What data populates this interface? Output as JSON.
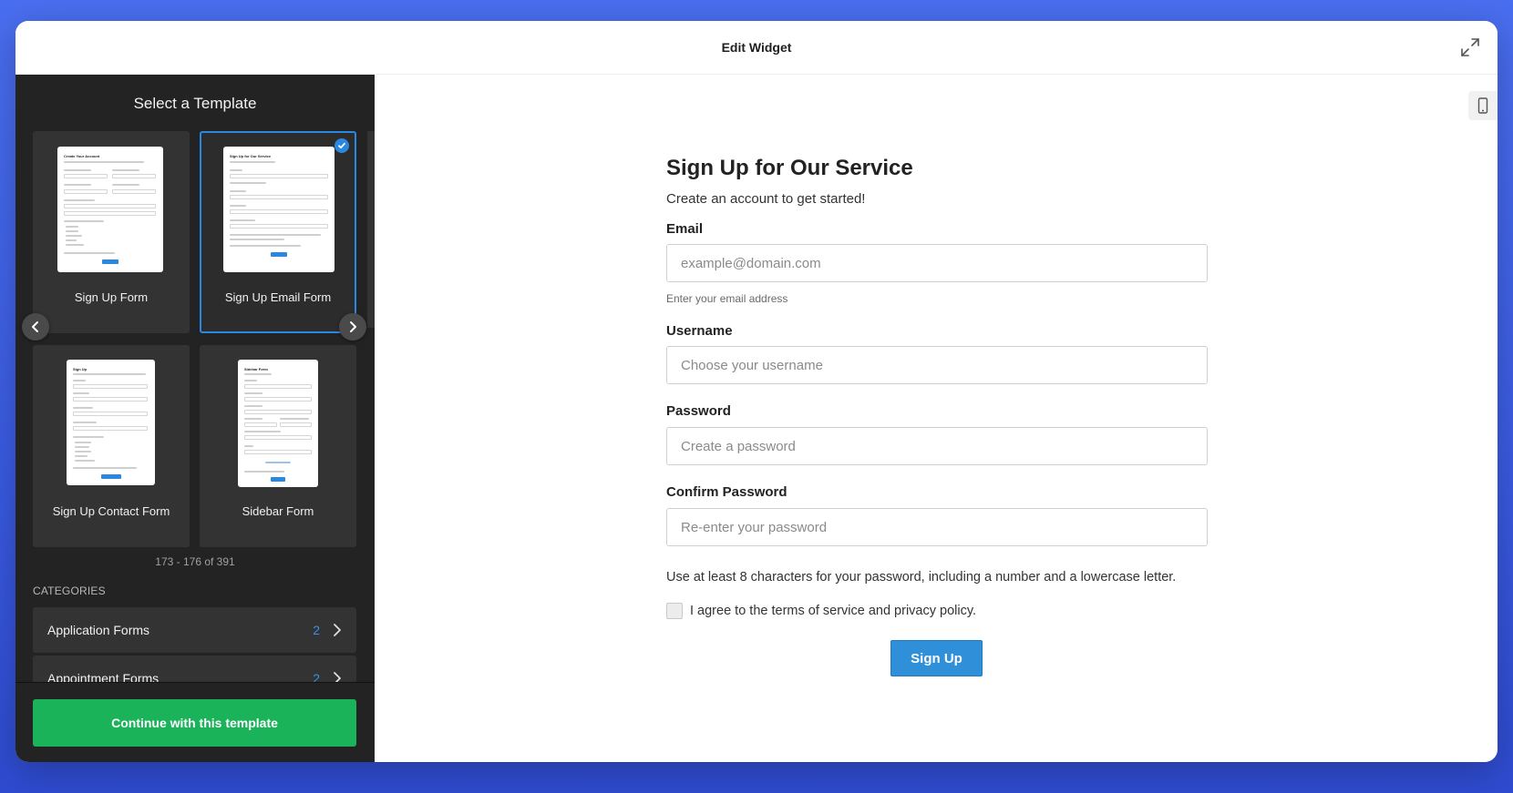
{
  "header": {
    "title": "Edit Widget",
    "expand_icon": "expand-icon"
  },
  "sidebar": {
    "title": "Select a Template",
    "templates": [
      {
        "label": "Sign Up Form",
        "selected": false
      },
      {
        "label": "Sign Up Email Form",
        "selected": true
      },
      {
        "label": "Sign Up Contact Form",
        "selected": false
      },
      {
        "label": "Sidebar Form",
        "selected": false
      }
    ],
    "thumbs": {
      "t1_title": "Create Your Account",
      "t2_title": "Sign Up for Our Service",
      "t3_title": "Sign Up",
      "t4_title": "Sidebar Form"
    },
    "pager": "173 - 176 of 391",
    "categories_heading": "CATEGORIES",
    "categories": [
      {
        "label": "Application Forms",
        "count": "2"
      },
      {
        "label": "Appointment Forms",
        "count": "2"
      }
    ],
    "continue_label": "Continue with this template"
  },
  "form": {
    "title": "Sign Up for Our Service",
    "subtitle": "Create an account to get started!",
    "email_label": "Email",
    "email_placeholder": "example@domain.com",
    "email_hint": "Enter your email address",
    "username_label": "Username",
    "username_placeholder": "Choose your username",
    "password_label": "Password",
    "password_placeholder": "Create a password",
    "confirm_label": "Confirm Password",
    "confirm_placeholder": "Re-enter your password",
    "password_rule": "Use at least 8 characters for your password, including a number and a lowercase letter.",
    "agree_text": "I agree to the terms of service and privacy policy.",
    "submit_label": "Sign Up"
  },
  "colors": {
    "accent": "#2b88e0",
    "continue_button": "#1bb35a",
    "sidebar_bg": "#232323",
    "page_bg": "#4a6ef0"
  }
}
